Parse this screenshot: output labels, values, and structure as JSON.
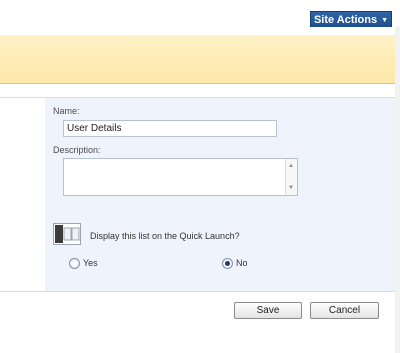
{
  "header": {
    "site_actions_label": "Site Actions"
  },
  "form": {
    "name_label": "Name:",
    "name_value": "User Details",
    "description_label": "Description:",
    "description_value": "",
    "quick_launch_question": "Display this list on the Quick Launch?",
    "options": [
      {
        "label": "Yes",
        "selected": false
      },
      {
        "label": "No",
        "selected": true
      }
    ]
  },
  "buttons": {
    "save_label": "Save",
    "cancel_label": "Cancel"
  }
}
